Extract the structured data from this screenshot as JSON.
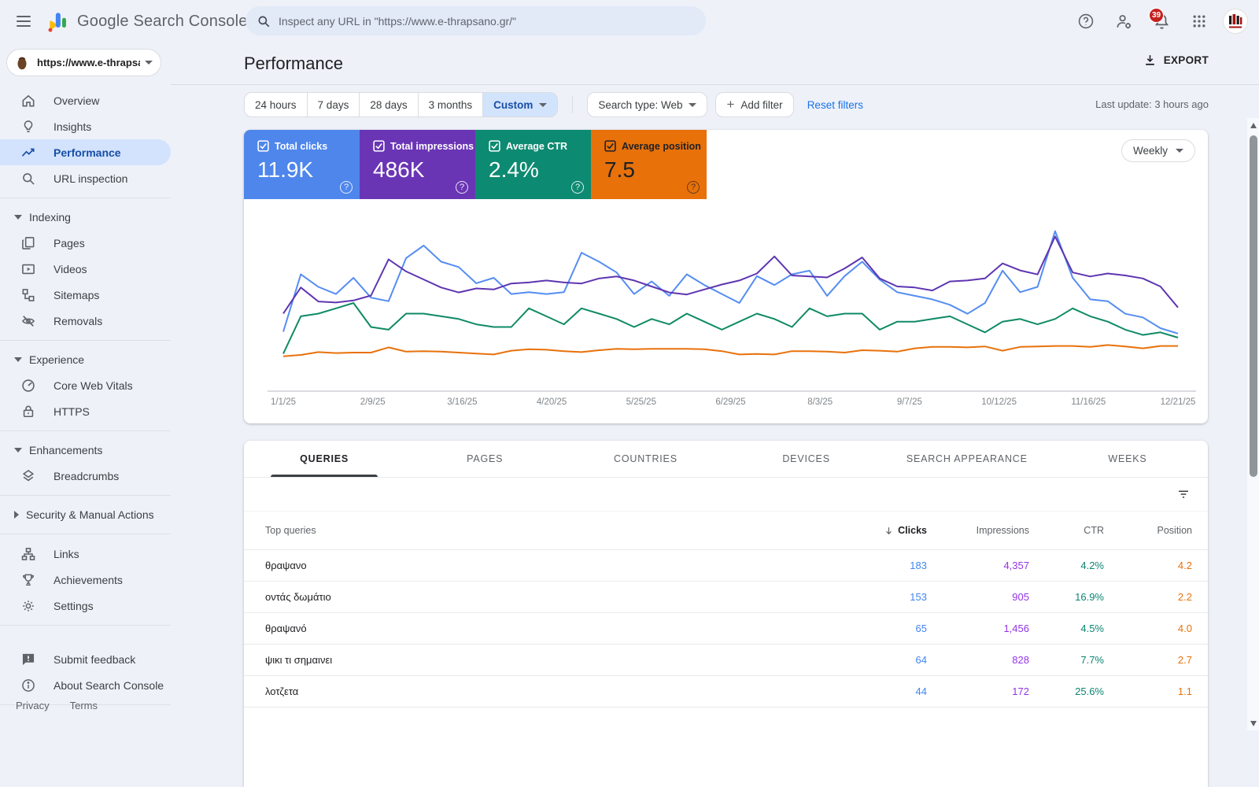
{
  "topbar": {
    "app_title": "Google Search Console",
    "search_placeholder": "Inspect any URL in \"https://www.e-thrapsano.gr/\"",
    "notification_count": "39"
  },
  "sidebar": {
    "property": "https://www.e-thrapsa...",
    "overview": "Overview",
    "insights": "Insights",
    "performance": "Performance",
    "url_inspection": "URL inspection",
    "indexing": "Indexing",
    "pages": "Pages",
    "videos": "Videos",
    "sitemaps": "Sitemaps",
    "removals": "Removals",
    "experience": "Experience",
    "core_web_vitals": "Core Web Vitals",
    "https": "HTTPS",
    "enhancements": "Enhancements",
    "breadcrumbs": "Breadcrumbs",
    "security": "Security & Manual Actions",
    "links": "Links",
    "achievements": "Achievements",
    "settings": "Settings",
    "submit_feedback": "Submit feedback",
    "about": "About Search Console",
    "privacy": "Privacy",
    "terms": "Terms"
  },
  "header": {
    "title": "Performance",
    "export_label": "EXPORT",
    "last_update": "Last update: 3 hours ago"
  },
  "filters": {
    "date_ranges": [
      "24 hours",
      "7 days",
      "28 days",
      "3 months",
      "Custom"
    ],
    "active_range": "Custom",
    "search_type": "Search type: Web",
    "add_filter": "Add filter",
    "reset": "Reset filters"
  },
  "metrics": {
    "cards": [
      {
        "label": "Total clicks",
        "value": "11.9K",
        "color": "#4e86ec",
        "text": "light",
        "checked": true
      },
      {
        "label": "Total impressions",
        "value": "486K",
        "color": "#6a35b5",
        "text": "light",
        "checked": true
      },
      {
        "label": "Average CTR",
        "value": "2.4%",
        "color": "#0d8a72",
        "text": "light",
        "checked": true
      },
      {
        "label": "Average position",
        "value": "7.5",
        "color": "#e8710a",
        "text": "dark",
        "checked": true
      }
    ]
  },
  "chart_controls": {
    "granularity": "Weekly"
  },
  "chart_data": {
    "type": "line",
    "title": "Search performance over time (weekly)",
    "grid": false,
    "legend_position": "none",
    "x_unit": "week starting",
    "x_tick_labels": [
      "1/1/25",
      "2/9/25",
      "3/16/25",
      "4/20/25",
      "5/25/25",
      "6/29/25",
      "8/3/25",
      "9/7/25",
      "10/12/25",
      "11/16/25",
      "12/21/25"
    ],
    "series": [
      {
        "name": "Clicks",
        "key": "clicks",
        "color": "#558df2",
        "axis_min": 0,
        "axis_max": 460,
        "total": "11.9K",
        "values": [
          150,
          310,
          275,
          255,
          300,
          245,
          235,
          355,
          390,
          345,
          330,
          285,
          300,
          255,
          260,
          255,
          260,
          370,
          345,
          315,
          255,
          290,
          250,
          310,
          280,
          255,
          230,
          305,
          280,
          310,
          320,
          250,
          305,
          345,
          295,
          260,
          250,
          240,
          225,
          200,
          230,
          320,
          260,
          275,
          430,
          300,
          240,
          235,
          200,
          190,
          160,
          145
        ]
      },
      {
        "name": "Impressions",
        "key": "impressions",
        "color": "#5e35b1",
        "axis_min": 0,
        "axis_max": 16500,
        "total": "486K",
        "values": [
          7200,
          9800,
          8400,
          8300,
          8500,
          9000,
          12600,
          11400,
          10600,
          9800,
          9300,
          9700,
          9600,
          10200,
          10300,
          10500,
          10300,
          10200,
          10700,
          10900,
          10500,
          9900,
          9300,
          9100,
          9600,
          10100,
          10500,
          11200,
          12900,
          11000,
          10900,
          10800,
          11700,
          12800,
          10700,
          9900,
          9800,
          9500,
          10400,
          10500,
          10700,
          12200,
          11500,
          11100,
          14900,
          11300,
          10900,
          11200,
          11000,
          10700,
          9900,
          7800
        ]
      },
      {
        "name": "CTR (%)",
        "key": "ctr",
        "color": "#0f8a65",
        "axis_min": 0,
        "axis_max": 6.2,
        "total": "2.4%",
        "values": [
          1.2,
          2.6,
          2.7,
          2.9,
          3.1,
          2.2,
          2.1,
          2.7,
          2.7,
          2.6,
          2.5,
          2.3,
          2.2,
          2.2,
          2.9,
          2.6,
          2.3,
          2.9,
          2.7,
          2.5,
          2.2,
          2.5,
          2.3,
          2.7,
          2.4,
          2.1,
          2.4,
          2.7,
          2.5,
          2.2,
          2.9,
          2.6,
          2.7,
          2.7,
          2.1,
          2.4,
          2.4,
          2.5,
          2.6,
          2.3,
          2.0,
          2.4,
          2.5,
          2.3,
          2.5,
          2.9,
          2.6,
          2.4,
          2.1,
          1.9,
          2.0,
          1.8
        ]
      },
      {
        "name": "Position",
        "key": "position",
        "color": "#e8710a",
        "axis_min": 0,
        "axis_max": 35,
        "total": "7.5",
        "values": [
          6.2,
          6.5,
          7.1,
          6.9,
          7.0,
          7.0,
          8.1,
          7.2,
          7.3,
          7.2,
          7.0,
          6.8,
          6.6,
          7.4,
          7.7,
          7.6,
          7.3,
          7.1,
          7.5,
          7.8,
          7.7,
          7.8,
          7.8,
          7.8,
          7.7,
          7.3,
          6.6,
          6.7,
          6.6,
          7.3,
          7.3,
          7.2,
          7.0,
          7.5,
          7.4,
          7.2,
          7.9,
          8.2,
          8.2,
          8.1,
          8.3,
          7.4,
          8.2,
          8.3,
          8.4,
          8.4,
          8.2,
          8.6,
          8.3,
          7.9,
          8.4,
          8.4
        ]
      }
    ]
  },
  "tabs": {
    "items": [
      "QUERIES",
      "PAGES",
      "COUNTRIES",
      "DEVICES",
      "SEARCH APPEARANCE",
      "WEEKS"
    ],
    "active": "QUERIES"
  },
  "table": {
    "first_column": "Top queries",
    "columns": [
      "Clicks",
      "Impressions",
      "CTR",
      "Position"
    ],
    "sorted_by": "Clicks",
    "rows": [
      {
        "query": "θραψανο",
        "clicks": "183",
        "impressions": "4,357",
        "ctr": "4.2%",
        "position": "4.2"
      },
      {
        "query": "οντάς δωμάτιο",
        "clicks": "153",
        "impressions": "905",
        "ctr": "16.9%",
        "position": "2.2"
      },
      {
        "query": "θραψανό",
        "clicks": "65",
        "impressions": "1,456",
        "ctr": "4.5%",
        "position": "4.0"
      },
      {
        "query": "ψικι τι σημαινει",
        "clicks": "64",
        "impressions": "828",
        "ctr": "7.7%",
        "position": "2.7"
      },
      {
        "query": "λοτζετα",
        "clicks": "44",
        "impressions": "172",
        "ctr": "25.6%",
        "position": "1.1"
      }
    ]
  }
}
